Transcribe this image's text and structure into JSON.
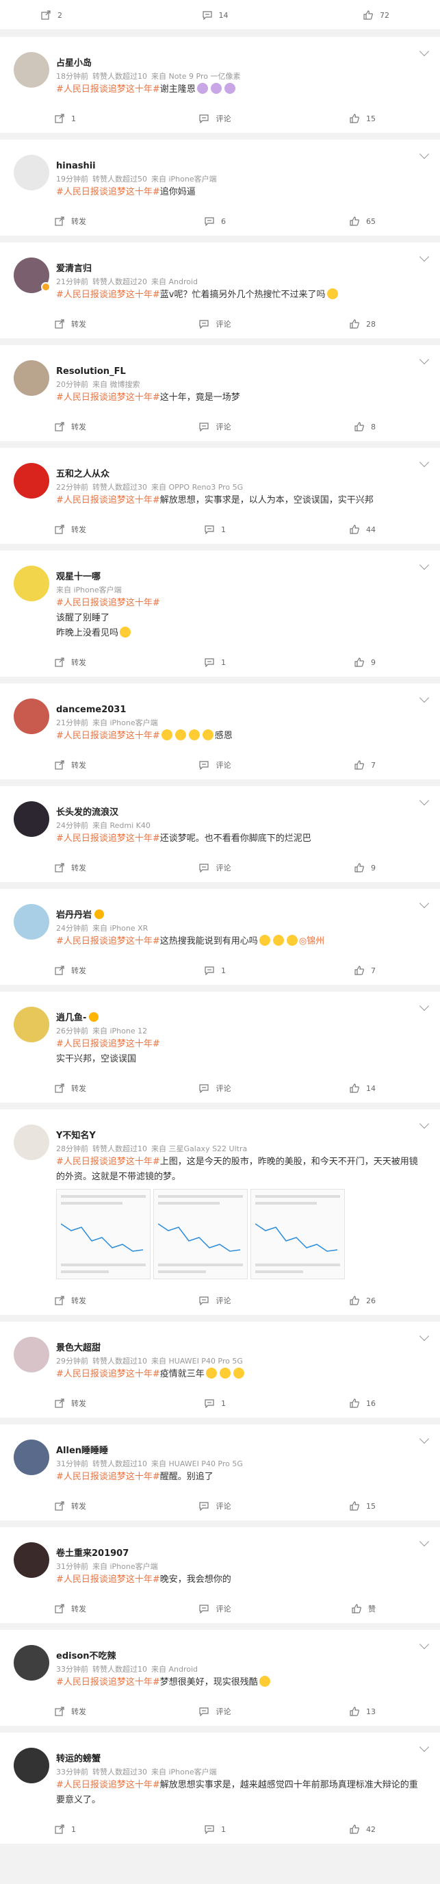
{
  "hashtag": "#人民日报谈追梦这十年#",
  "labels": {
    "repost": "转发",
    "comment": "评论",
    "like": "赞"
  },
  "top_actions": {
    "repost": "2",
    "comment": "14",
    "like": "72"
  },
  "posts": [
    {
      "name": "占星小岛",
      "time": "18分钟前",
      "reposts": "转赞人数超过10",
      "source": "来自 Note 9 Pro 一亿像素",
      "text": "谢主隆恩",
      "emoji_after": 3,
      "emoji_style": "purple",
      "repost": "1",
      "comment": "评论",
      "like": "15",
      "avatar_color": "#cfc6bb"
    },
    {
      "name": "hinashii",
      "time": "19分钟前",
      "reposts": "转赞人数超过50",
      "source": "来自 iPhone客户端",
      "text": "追你妈逼",
      "repost": "转发",
      "comment": "6",
      "like": "65",
      "avatar_color": "#e8e8e8"
    },
    {
      "name": "爱清言归",
      "time": "21分钟前",
      "reposts": "转赞人数超过20",
      "source": "来自 Android",
      "text": "蓝v呢？忙着搞另外几个热搜忙不过来了吗",
      "emoji_after": 1,
      "repost": "转发",
      "comment": "评论",
      "like": "28",
      "avatar_color": "#7a5f6e",
      "vbadge": true
    },
    {
      "name": "Resolution_FL",
      "time": "20分钟前",
      "reposts": "",
      "source": "来自 微博搜索",
      "text": "这十年，竟是一场梦",
      "repost": "转发",
      "comment": "评论",
      "like": "8",
      "avatar_color": "#b9a48e"
    },
    {
      "name": "五和之人从众",
      "time": "22分钟前",
      "reposts": "转赞人数超过30",
      "source": "来自 OPPO Reno3 Pro 5G",
      "text": "解放思想，实事求是，以人为本，空谈误国，实干兴邦",
      "repost": "转发",
      "comment": "1",
      "like": "44",
      "avatar_color": "#d9231d"
    },
    {
      "name": "观星十一哪",
      "time": "",
      "reposts": "",
      "source": "来自 iPhone客户端",
      "text": "",
      "extra_lines": [
        "该醒了别睡了",
        "昨晚上没看见吗"
      ],
      "emoji_after_last": 1,
      "repost": "转发",
      "comment": "1",
      "like": "9",
      "avatar_color": "#f2d54b"
    },
    {
      "name": "danceme2031",
      "time": "21分钟前",
      "reposts": "",
      "source": "来自 iPhone客户端",
      "text": "感恩",
      "emoji_before_text": 4,
      "repost": "转发",
      "comment": "评论",
      "like": "7",
      "avatar_color": "#c95a4e"
    },
    {
      "name": "长头发的流浪汉",
      "time": "24分钟前",
      "reposts": "",
      "source": "来自 Redmi K40",
      "text": "还谈梦呢。也不看看你脚底下的烂泥巴",
      "repost": "转发",
      "comment": "评论",
      "like": "9",
      "avatar_color": "#2b2630"
    },
    {
      "name": "岩丹丹岩",
      "time": "24分钟前",
      "reposts": "",
      "source": "来自 iPhone XR",
      "text": "这热搜我能说到有用心吗",
      "emoji_after": 3,
      "location": "锦州",
      "repost": "转发",
      "comment": "1",
      "like": "7",
      "avatar_color": "#a8cfe6",
      "name_emoji": true
    },
    {
      "name": "逍几鱼-",
      "time": "26分钟前",
      "reposts": "",
      "source": "来自 iPhone 12",
      "text": "",
      "extra_lines": [
        "实干兴邦，空谈误国"
      ],
      "repost": "转发",
      "comment": "评论",
      "like": "14",
      "avatar_color": "#e7c65a",
      "name_emoji": true
    },
    {
      "name": "Y不知名Y",
      "time": "28分钟前",
      "reposts": "转赞人数超过10",
      "source": "来自 三星Galaxy S22 Ultra",
      "text": "上图，这是今天的股市，昨晚的美股，和今天不开门，天天被用镜的外资。这就是不带滤镜的梦。",
      "images": 3,
      "repost": "转发",
      "comment": "评论",
      "like": "26",
      "avatar_color": "#e9e4dd"
    },
    {
      "name": "景色大超甜",
      "time": "29分钟前",
      "reposts": "转赞人数超过10",
      "source": "来自 HUAWEI P40 Pro 5G",
      "text": "疫情就三年",
      "emoji_after": 3,
      "repost": "转发",
      "comment": "1",
      "like": "16",
      "avatar_color": "#d7c3c8"
    },
    {
      "name": "Allen睡睡睡",
      "time": "31分钟前",
      "reposts": "转赞人数超过10",
      "source": "来自 HUAWEI P40 Pro 5G",
      "text": "醒醒。别追了",
      "repost": "转发",
      "comment": "评论",
      "like": "15",
      "avatar_color": "#5a6a8a"
    },
    {
      "name": "卷土重来201907",
      "time": "31分钟前",
      "reposts": "",
      "source": "来自 iPhone客户端",
      "text": "晚安，我会想你的",
      "repost": "转发",
      "comment": "评论",
      "like": "赞",
      "avatar_color": "#3a2a2a"
    },
    {
      "name": "edison不吃辣",
      "time": "33分钟前",
      "reposts": "转赞人数超过10",
      "source": "来自 Android",
      "text": "梦想很美好，现实很残酷",
      "emoji_after": 1,
      "repost": "转发",
      "comment": "评论",
      "like": "13",
      "avatar_color": "#3f3f3f"
    },
    {
      "name": "转运的螃蟹",
      "time": "33分钟前",
      "reposts": "转赞人数超过30",
      "source": "来自 iPhone客户端",
      "text": "解放思想实事求是，越来越感觉四十年前那场真理标准大辩论的重要意义了。",
      "repost": "1",
      "comment": "1",
      "like": "42",
      "avatar_color": "#333333"
    }
  ]
}
